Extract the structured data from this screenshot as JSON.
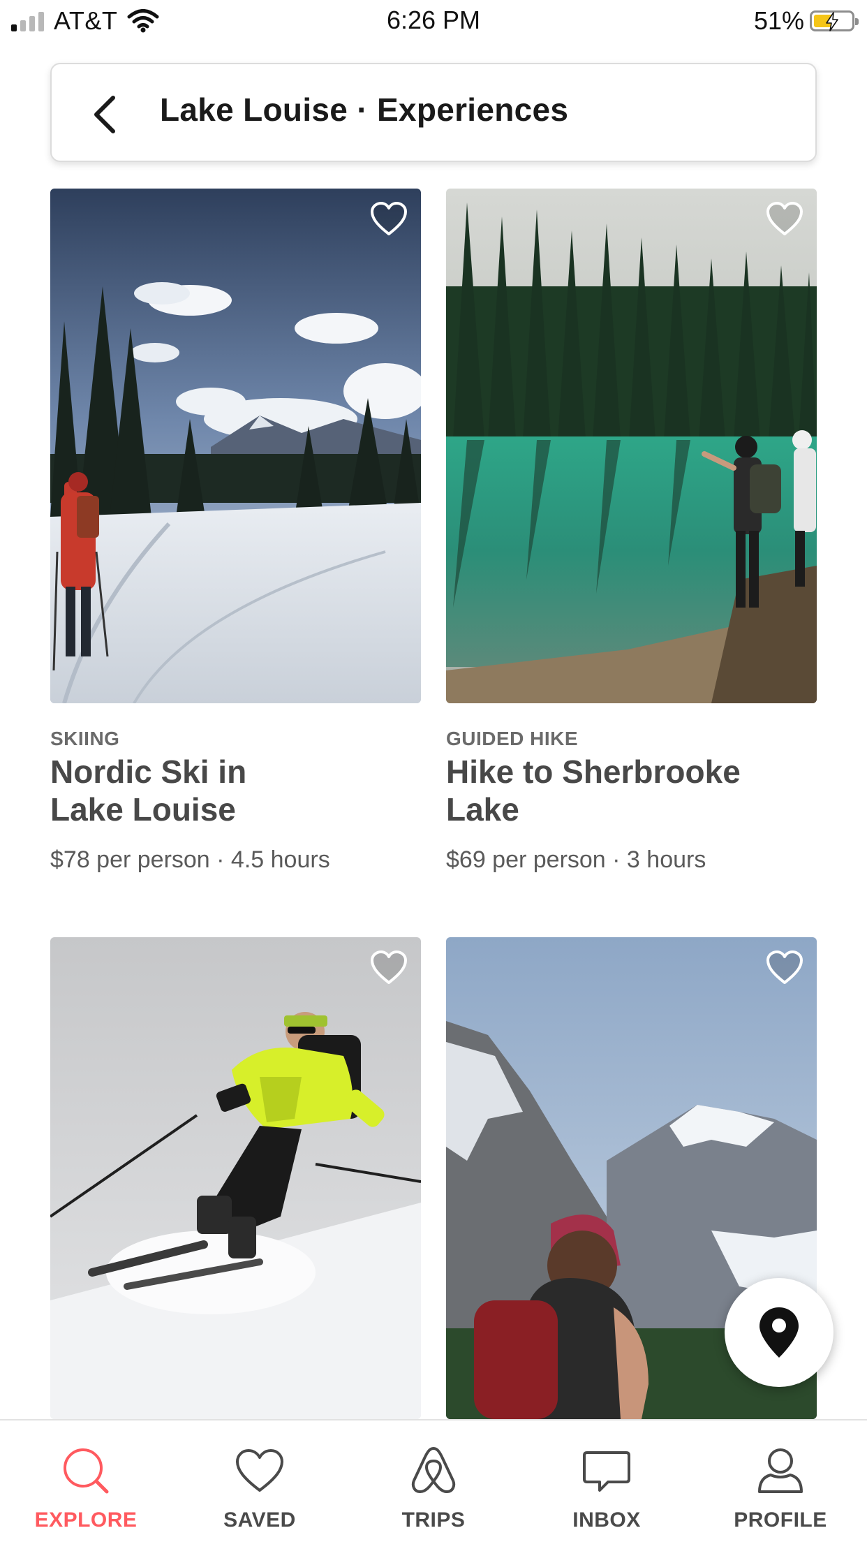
{
  "status_bar": {
    "carrier": "AT&T",
    "time": "6:26 PM",
    "battery": "51%",
    "battery_level": 0.51,
    "battery_color": "#f5c518"
  },
  "header": {
    "back_icon": "chevron-left-icon",
    "title": "Lake Louise · Experiences"
  },
  "experiences": [
    {
      "category": "SKIING",
      "title": "Nordic Ski in Lake Louise",
      "price_duration": "$78 per person · 4.5 hours",
      "image": "cross-country skier on snowy trail with pines and mountains"
    },
    {
      "category": "GUIDED HIKE",
      "title": "Hike to Sherbrooke Lake",
      "price_duration": "$69 per person · 3 hours",
      "image": "hikers at turquoise lake with conifer forest"
    },
    {
      "category": "",
      "title": "",
      "price_duration": "",
      "image": "downhill skier in yellow jacket on snow"
    },
    {
      "category": "",
      "title": "",
      "price_duration": "",
      "image": "hiker with red cap facing snowy mountains"
    }
  ],
  "map_button": {
    "icon": "map-pin-icon"
  },
  "tab_bar": {
    "active_color": "#ff5a5f",
    "tabs": [
      {
        "label": "EXPLORE",
        "icon": "search-icon",
        "active": true
      },
      {
        "label": "SAVED",
        "icon": "heart-icon",
        "active": false
      },
      {
        "label": "TRIPS",
        "icon": "airbnb-logo-icon",
        "active": false
      },
      {
        "label": "INBOX",
        "icon": "chat-bubble-icon",
        "active": false
      },
      {
        "label": "PROFILE",
        "icon": "user-icon",
        "active": false
      }
    ]
  }
}
